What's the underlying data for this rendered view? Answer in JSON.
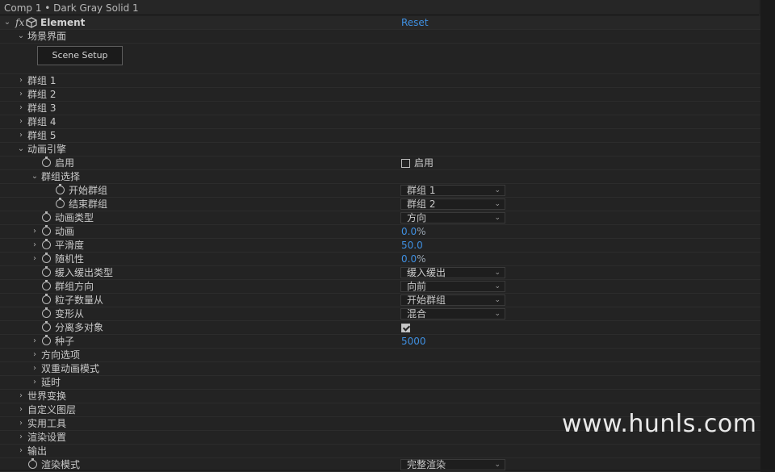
{
  "title": "Comp 1 • Dark Gray Solid 1",
  "effect": {
    "name": "Element",
    "reset_label": "Reset"
  },
  "scene_section": "场景界面",
  "scene_setup_button": "Scene Setup",
  "groups": [
    "群组 1",
    "群组 2",
    "群组 3",
    "群组 4",
    "群组 5"
  ],
  "anim_engine": {
    "label": "动画引擎",
    "enable_label": "启用",
    "enable_checkbox_label": "启用",
    "group_select_label": "群组选择",
    "start_group_label": "开始群组",
    "start_group_value": "群组 1",
    "end_group_label": "结束群组",
    "end_group_value": "群组 2",
    "anim_type_label": "动画类型",
    "anim_type_value": "方向",
    "anim_label": "动画",
    "anim_value": "0.0",
    "anim_unit": "%",
    "smooth_label": "平滑度",
    "smooth_value": "50.0",
    "random_label": "随机性",
    "random_value": "0.0",
    "random_unit": "%",
    "ease_label": "缓入缓出类型",
    "ease_value": "缓入缓出",
    "group_dir_label": "群组方向",
    "group_dir_value": "向前",
    "particle_count_label": "粒子数量从",
    "particle_count_value": "开始群组",
    "transform_label": "变形从",
    "transform_value": "混合",
    "separate_label": "分离多对象",
    "seed_label": "种子",
    "seed_value": "5000",
    "dir_options_label": "方向选项",
    "dual_anim_label": "双重动画模式",
    "delay_label": "延时"
  },
  "sections": {
    "world": "世界变换",
    "custom_layers": "自定义图层",
    "utilities": "实用工具",
    "render_settings": "渲染设置",
    "output": "输出"
  },
  "render_mode": {
    "label": "渲染模式",
    "value": "完整渲染"
  },
  "watermark": "www.hunls.com"
}
